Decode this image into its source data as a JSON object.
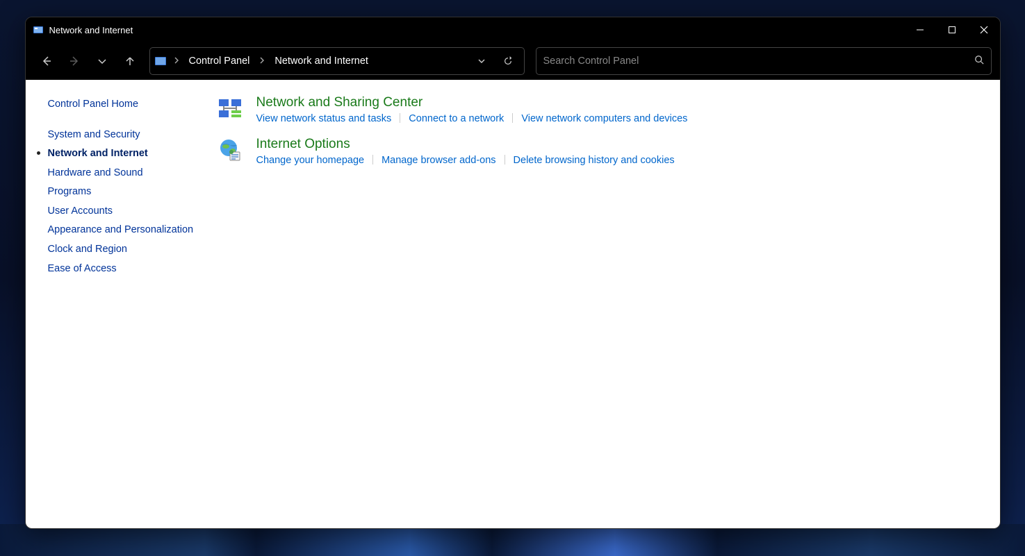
{
  "window": {
    "title": "Network and Internet"
  },
  "breadcrumb": {
    "items": [
      "Control Panel",
      "Network and Internet"
    ]
  },
  "search": {
    "placeholder": "Search Control Panel"
  },
  "sidebar": {
    "home": "Control Panel Home",
    "items": [
      {
        "label": "System and Security",
        "current": false
      },
      {
        "label": "Network and Internet",
        "current": true
      },
      {
        "label": "Hardware and Sound",
        "current": false
      },
      {
        "label": "Programs",
        "current": false
      },
      {
        "label": "User Accounts",
        "current": false
      },
      {
        "label": "Appearance and Personalization",
        "current": false
      },
      {
        "label": "Clock and Region",
        "current": false
      },
      {
        "label": "Ease of Access",
        "current": false
      }
    ]
  },
  "categories": [
    {
      "title": "Network and Sharing Center",
      "icon": "network-icon",
      "tasks": [
        "View network status and tasks",
        "Connect to a network",
        "View network computers and devices"
      ]
    },
    {
      "title": "Internet Options",
      "icon": "internet-options-icon",
      "tasks": [
        "Change your homepage",
        "Manage browser add-ons",
        "Delete browsing history and cookies"
      ]
    }
  ]
}
